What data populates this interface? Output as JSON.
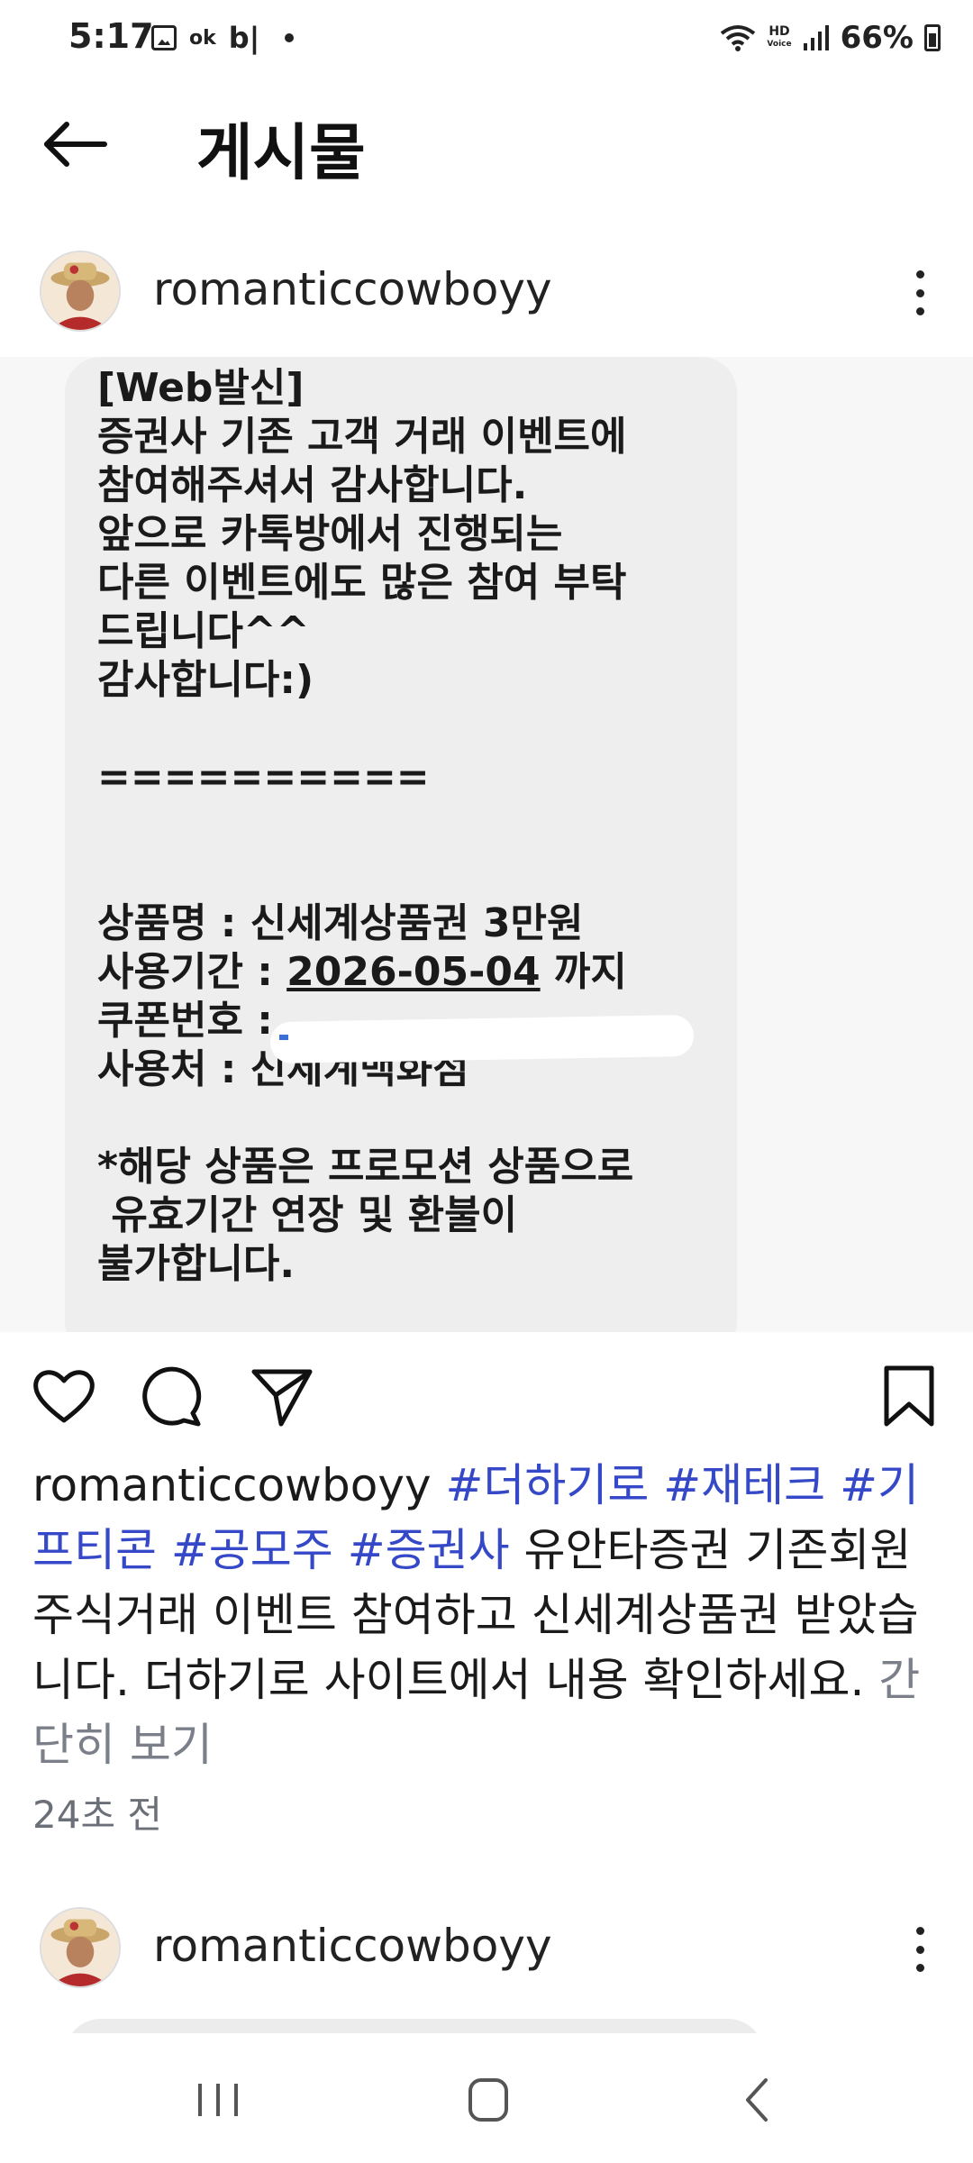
{
  "status_bar": {
    "time": "5:17",
    "ok_label": "ok",
    "b_label": "b|",
    "hd_label": "HD",
    "voice_label": "Voice",
    "battery": "66%"
  },
  "header": {
    "title": "게시물",
    "back_icon": "arrow-left-icon"
  },
  "post": {
    "username": "romanticcowboyy",
    "image_message": {
      "lines": [
        "[Web발신]",
        "증권사 기존 고객 거래 이벤트에",
        "참여해주셔서 감사합니다.",
        "앞으로 카톡방에서 진행되는",
        "다른 이벤트에도 많은 참여 부탁",
        "드립니다^^",
        "감사합니다:)",
        "",
        "==========",
        "",
        "",
        "상품명 : 신세계상품권 3만원"
      ],
      "period_label": "사용기간 : ",
      "period_date": "2026-05-04",
      "period_suffix": " 까지",
      "coupon_label": "쿠폰번호 : ",
      "place": "사용처 : 신세계백화점",
      "notice_lines": [
        "",
        "*해당 상품은 프로모션 상품으로",
        " 유효기간 연장 및 환불이",
        "불가합니다."
      ]
    },
    "caption": {
      "username": "romanticcowboyy",
      "tags": [
        "#더하기로",
        "#재테크",
        "#기프티콘",
        "#공모주",
        "#증권사"
      ],
      "text": "유안타증권 기존회원 주식거래 이벤트 참여하고 신세계상품권 받았습니다. 더하기로 사이트에서 내용 확인하세요.",
      "more": "간단히 보기"
    },
    "timestamp": "24초 전"
  },
  "next_post": {
    "username": "romanticcowboyy"
  },
  "colors": {
    "hashtag": "#3548c8",
    "muted": "#6b6f78",
    "bubble": "#eeeeee"
  }
}
